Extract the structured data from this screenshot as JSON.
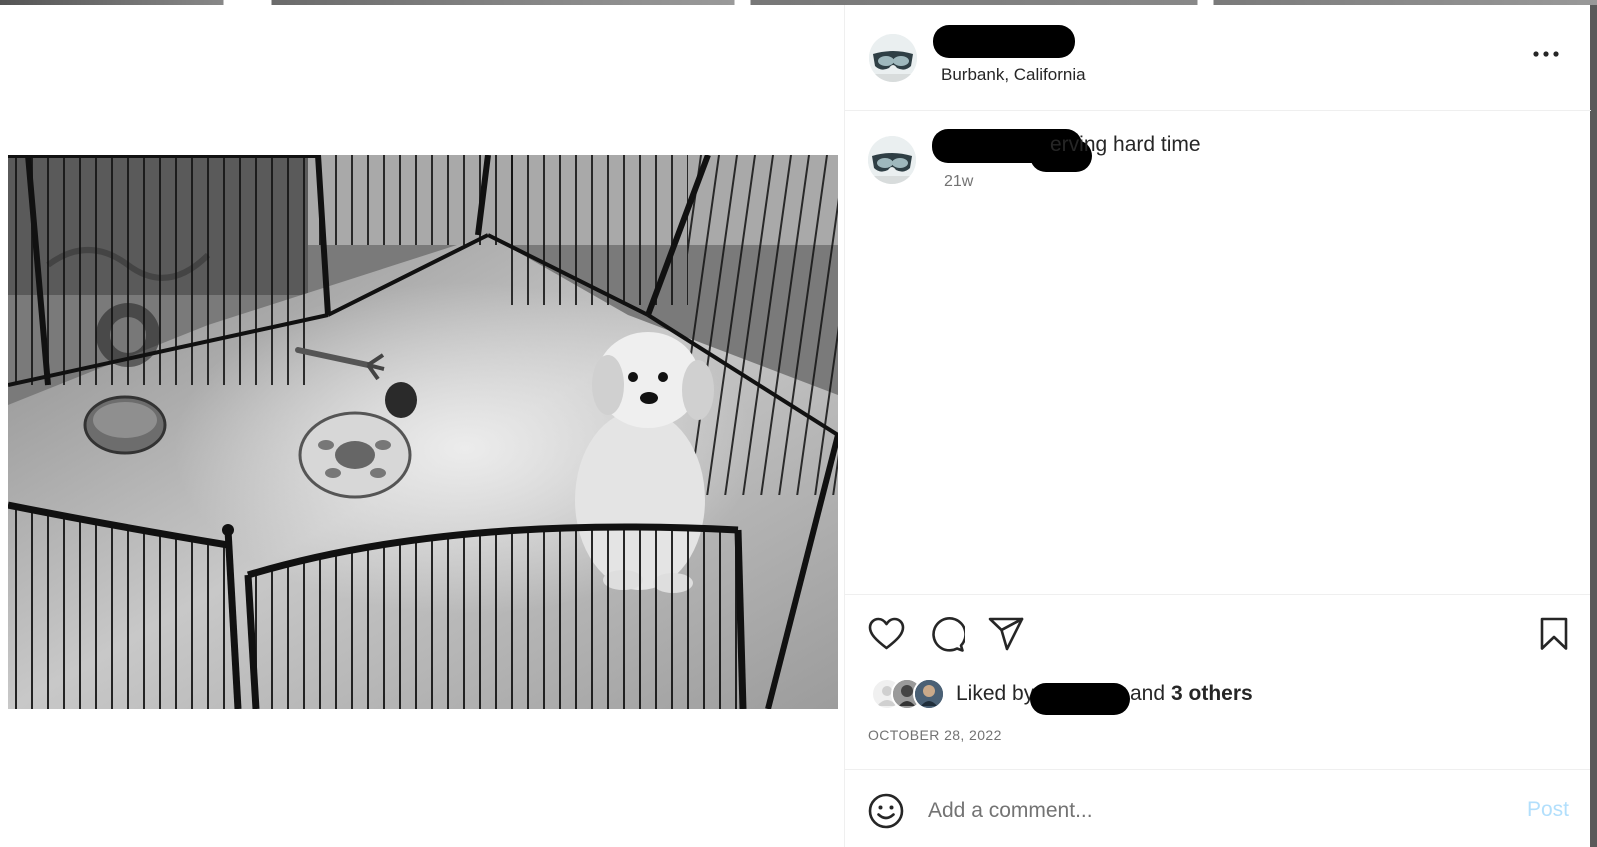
{
  "post": {
    "location": "Burbank, California",
    "caption_visible": "erving hard time",
    "age": "21w",
    "date": "OCTOBER 28, 2022"
  },
  "likes": {
    "prefix": "Liked by",
    "middle": "and",
    "others": "3 others"
  },
  "comment": {
    "placeholder": "Add a comment...",
    "post_label": "Post"
  },
  "icons": {
    "more": "more-options-icon",
    "like": "heart-icon",
    "comment": "comment-bubble-icon",
    "share": "paper-plane-icon",
    "save": "bookmark-icon",
    "emoji": "smiley-icon"
  },
  "colors": {
    "text": "#262626",
    "secondary": "#737373",
    "post_disabled": "#b2dffc",
    "border": "#efefef"
  }
}
